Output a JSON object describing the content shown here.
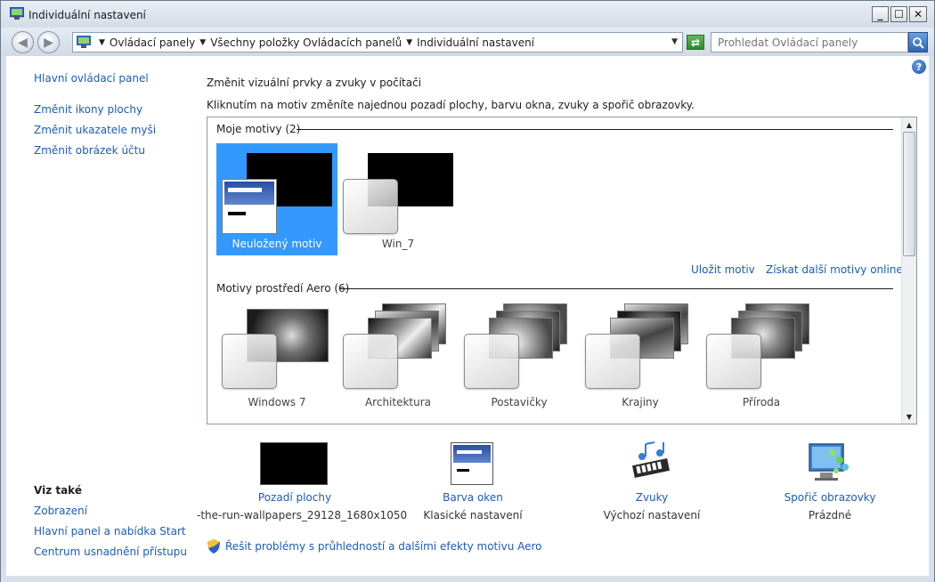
{
  "window": {
    "title": "Individuální nastavení",
    "controls": {
      "minimize": "_",
      "maximize": "☐",
      "close": "✕"
    }
  },
  "addressbar": {
    "breadcrumbs": [
      "Ovládací panely",
      "Všechny položky Ovládacích panelů",
      "Individuální nastavení"
    ],
    "search_placeholder": "Prohledat Ovládací panely"
  },
  "sidebar": {
    "home": "Hlavní ovládací panel",
    "links": [
      "Změnit ikony plochy",
      "Změnit ukazatele myši",
      "Změnit obrázek účtu"
    ],
    "see_also_title": "Viz také",
    "see_also": [
      "Zobrazení",
      "Hlavní panel a nabídka Start",
      "Centrum usnadnění přístupu"
    ]
  },
  "main": {
    "title": "Změnit vizuální prvky a zvuky v počítači",
    "description": "Kliknutím na motiv změníte najednou pozadí plochy, barvu okna, zvuky a spořič obrazovky.",
    "my_themes_header": "Moje motivy (2)",
    "my_themes": [
      {
        "name": "Neuložený motiv",
        "selected": true
      },
      {
        "name": "Win_7",
        "selected": false
      }
    ],
    "save_theme": "Uložit motiv",
    "more_themes": "Získat další motivy online",
    "aero_header": "Motivy prostředí Aero (6)",
    "aero_themes": [
      "Windows 7",
      "Architektura",
      "Postavičky",
      "Krajiny",
      "Příroda"
    ]
  },
  "settings": [
    {
      "label": "Pozadí plochy",
      "value": "-the-run-wallpapers_29128_1680x1050",
      "icon": "black-rect-icon"
    },
    {
      "label": "Barva oken",
      "value": "Klasické nastavení",
      "icon": "window-color-icon"
    },
    {
      "label": "Zvuky",
      "value": "Výchozí nastavení",
      "icon": "music-notes-icon"
    },
    {
      "label": "Spořič obrazovky",
      "value": "Prázdné",
      "icon": "screensaver-icon"
    }
  ],
  "aero_fix_link": "Řešit problémy s průhledností a dalšími efekty motivu Aero",
  "colors": {
    "link": "#1c5cb8",
    "selection": "#3399ff",
    "frame": "#d7e0ea"
  }
}
